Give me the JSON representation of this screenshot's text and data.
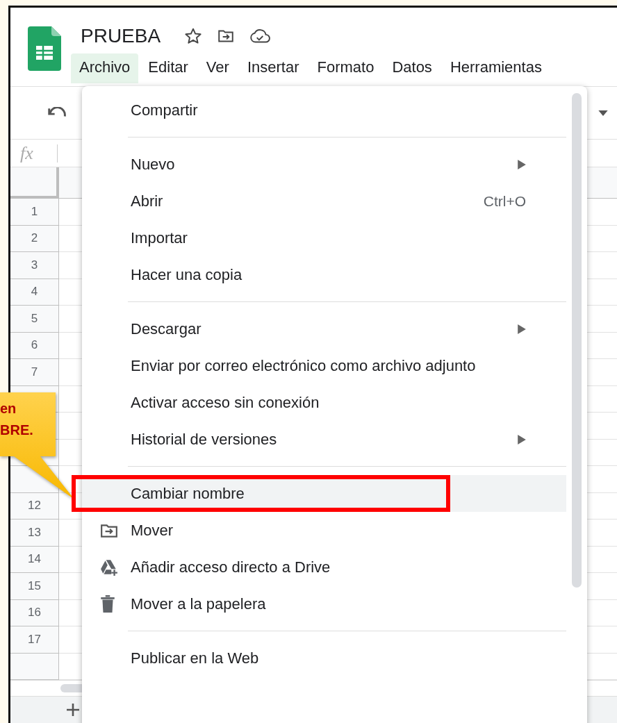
{
  "document": {
    "title": "PRUEBA"
  },
  "menubar": [
    {
      "label": "Archivo",
      "selected": true
    },
    {
      "label": "Editar",
      "selected": false
    },
    {
      "label": "Ver",
      "selected": false
    },
    {
      "label": "Insertar",
      "selected": false
    },
    {
      "label": "Formato",
      "selected": false
    },
    {
      "label": "Datos",
      "selected": false
    },
    {
      "label": "Herramientas",
      "selected": false
    }
  ],
  "formula_bar": {
    "label": "fx"
  },
  "row_numbers": [
    {
      "number": "1"
    },
    {
      "number": "2"
    },
    {
      "number": "3"
    },
    {
      "number": "4"
    },
    {
      "number": "5"
    },
    {
      "number": "6"
    },
    {
      "number": "7"
    },
    {
      "covered": true
    },
    {
      "covered": true
    },
    {
      "covered": true
    },
    {
      "covered": true
    },
    {
      "number": "12"
    },
    {
      "number": "13"
    },
    {
      "number": "14"
    },
    {
      "number": "15"
    },
    {
      "number": "16"
    },
    {
      "number": "17"
    },
    {
      "covered": true
    }
  ],
  "file_menu": [
    {
      "kind": "item",
      "label": "Compartir",
      "submenu": false,
      "selected": false,
      "framed": false
    },
    {
      "kind": "separator"
    },
    {
      "kind": "item",
      "label": "Nuevo",
      "submenu": true,
      "selected": false,
      "framed": false
    },
    {
      "kind": "item",
      "label": "Abrir",
      "shortcut": "Ctrl+O",
      "submenu": false,
      "selected": false,
      "framed": false
    },
    {
      "kind": "item",
      "label": "Importar",
      "submenu": false,
      "selected": false,
      "framed": false
    },
    {
      "kind": "item",
      "label": "Hacer una copia",
      "submenu": false,
      "selected": false,
      "framed": false
    },
    {
      "kind": "separator"
    },
    {
      "kind": "item",
      "label": "Descargar",
      "submenu": true,
      "selected": false,
      "framed": false
    },
    {
      "kind": "item",
      "label": "Enviar por correo electrónico como archivo adjunto",
      "submenu": false,
      "selected": false,
      "framed": false
    },
    {
      "kind": "item",
      "label": "Activar acceso sin conexión",
      "submenu": false,
      "selected": false,
      "framed": false
    },
    {
      "kind": "item",
      "label": "Historial de versiones",
      "submenu": true,
      "selected": false,
      "framed": false
    },
    {
      "kind": "separator"
    },
    {
      "kind": "item",
      "label": "Cambiar nombre",
      "submenu": false,
      "selected": true,
      "framed": true
    },
    {
      "kind": "item",
      "label": "Mover",
      "submenu": false,
      "selected": false,
      "framed": false
    },
    {
      "kind": "item",
      "label": "Añadir acceso directo a Drive",
      "submenu": false,
      "selected": false,
      "framed": false
    },
    {
      "kind": "item",
      "label": "Mover a la papelera",
      "submenu": false,
      "selected": false,
      "framed": false
    },
    {
      "kind": "separator"
    },
    {
      "kind": "item",
      "label": "Publicar en la Web",
      "submenu": false,
      "selected": false,
      "framed": false
    }
  ],
  "callout": {
    "lines": [
      "en",
      "BRE."
    ]
  }
}
